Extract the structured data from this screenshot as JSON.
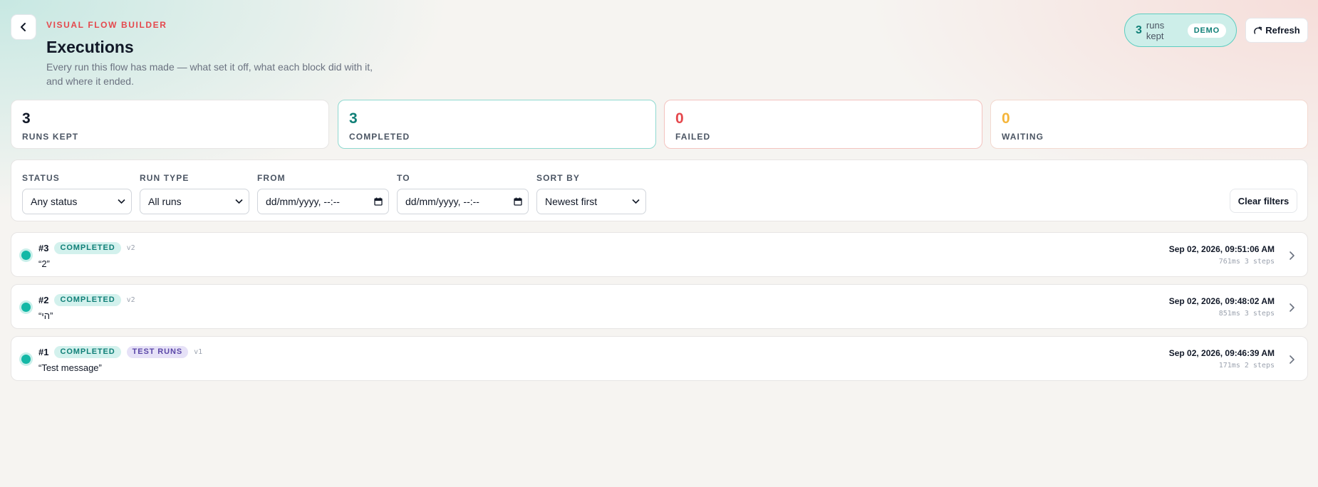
{
  "header": {
    "eyebrow": "VISUAL FLOW BUILDER",
    "title": "Executions",
    "description": "Every run this flow has made — what set it off, what each block did with it, and where it ended.",
    "runs_pill": {
      "count": "3",
      "label": "runs kept",
      "badge": "DEMO"
    },
    "refresh_label": "Refresh"
  },
  "stats": {
    "kept": {
      "value": "3",
      "label": "RUNS KEPT"
    },
    "completed": {
      "value": "3",
      "label": "COMPLETED"
    },
    "failed": {
      "value": "0",
      "label": "FAILED"
    },
    "waiting": {
      "value": "0",
      "label": "WAITING"
    }
  },
  "filters": {
    "status": {
      "label": "STATUS",
      "value": "Any status"
    },
    "run_type": {
      "label": "RUN TYPE",
      "value": "All runs"
    },
    "from": {
      "label": "FROM",
      "placeholder": "dd/mm/yyyy, --:--"
    },
    "to": {
      "label": "TO",
      "placeholder": "dd/mm/yyyy, --:--"
    },
    "sort_by": {
      "label": "SORT BY",
      "value": "Newest first"
    },
    "clear_label": "Clear filters"
  },
  "runs": [
    {
      "number": "#3",
      "status": "COMPLETED",
      "tag": "",
      "version": "v2",
      "message": "“2”",
      "timestamp": "Sep 02, 2026, 09:51:06 AM",
      "duration": "761ms",
      "steps": "3 steps"
    },
    {
      "number": "#2",
      "status": "COMPLETED",
      "tag": "",
      "version": "v2",
      "message": "“הי”",
      "timestamp": "Sep 02, 2026, 09:48:02 AM",
      "duration": "851ms",
      "steps": "3 steps"
    },
    {
      "number": "#1",
      "status": "COMPLETED",
      "tag": "TEST RUNS",
      "version": "v1",
      "message": "“Test message”",
      "timestamp": "Sep 02, 2026, 09:46:39 AM",
      "duration": "171ms",
      "steps": "2 steps"
    }
  ],
  "colors": {
    "accent_teal": "#0f7f77",
    "danger": "#e5484d",
    "warning": "#f5b53a",
    "eyebrow": "#e5484d"
  }
}
